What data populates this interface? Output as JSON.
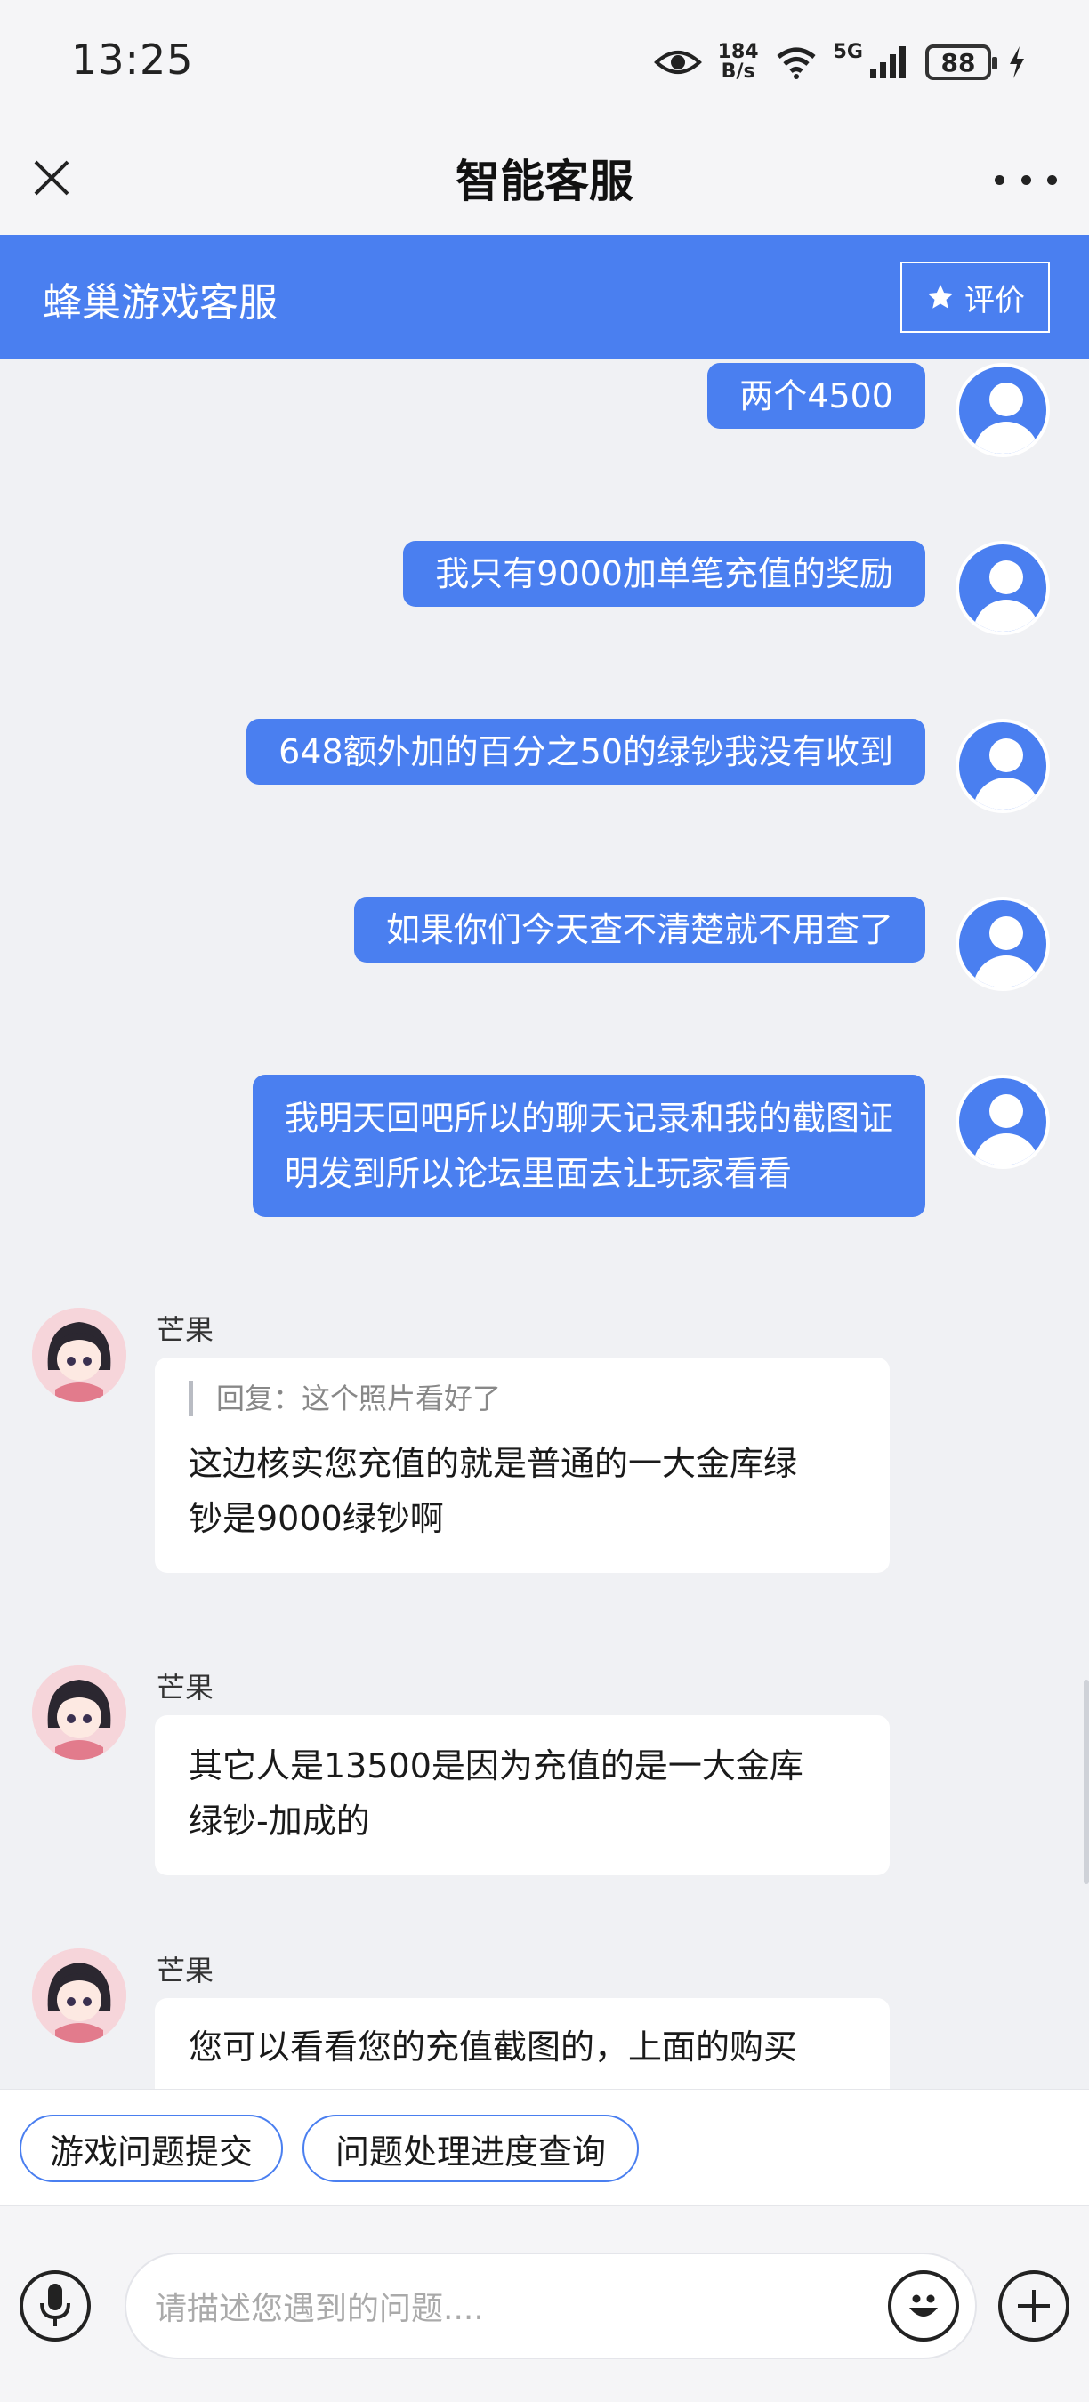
{
  "status_bar": {
    "time": "13:25",
    "net_speed_value": "184",
    "net_speed_unit": "B/s",
    "network_type": "5G",
    "battery": "88"
  },
  "nav": {
    "title": "智能客服"
  },
  "service_bar": {
    "title": "蜂巢游戏客服",
    "rate_label": "评价"
  },
  "messages": {
    "user": [
      {
        "text": "两个4500"
      },
      {
        "text": "我只有9000加单笔充值的奖励"
      },
      {
        "text": "648额外加的百分之50的绿钞我没有收到"
      },
      {
        "text": "如果你们今天查不清楚就不用查了"
      },
      {
        "line1": "我明天回吧所以的聊天记录和我的截图证",
        "line2": "明发到所以论坛里面去让玩家看看"
      }
    ],
    "agent": [
      {
        "name": "芒果",
        "quote": "回复：这个照片看好了",
        "line1": "这边核实您充值的就是普通的一大金库绿",
        "line2": "钞是9000绿钞啊"
      },
      {
        "name": "芒果",
        "line1": "其它人是13500是因为充值的是一大金库",
        "line2": "绿钞-加成的"
      },
      {
        "name": "芒果",
        "line1": "您可以看看您的充值截图的，上面的购买"
      }
    ]
  },
  "quick_actions": [
    "游戏问题提交",
    "问题处理进度查询"
  ],
  "input": {
    "placeholder": "请描述您遇到的问题...."
  },
  "colors": {
    "accent": "#4a7ff0",
    "chat_background": "#f0f1f4",
    "bubble_agent": "#ffffff"
  }
}
